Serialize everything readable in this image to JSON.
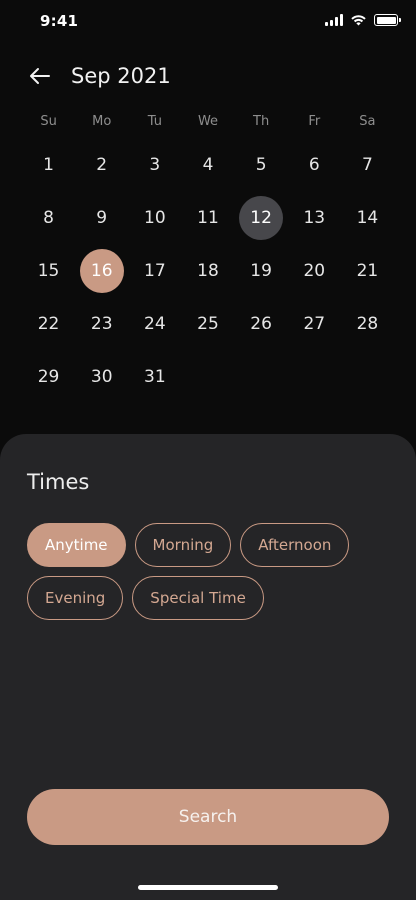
{
  "status_bar": {
    "time": "9:41"
  },
  "header": {
    "month_title": "Sep 2021"
  },
  "calendar": {
    "weekdays": [
      "Su",
      "Mo",
      "Tu",
      "We",
      "Th",
      "Fr",
      "Sa"
    ],
    "days": [
      "1",
      "2",
      "3",
      "4",
      "5",
      "6",
      "7",
      "8",
      "9",
      "10",
      "11",
      "12",
      "13",
      "14",
      "15",
      "16",
      "17",
      "18",
      "19",
      "20",
      "21",
      "22",
      "23",
      "24",
      "25",
      "26",
      "27",
      "28",
      "29",
      "30",
      "31"
    ],
    "today": "12",
    "selected": "16"
  },
  "times_sheet": {
    "title": "Times",
    "chips": [
      "Anytime",
      "Morning",
      "Afternoon",
      "Evening",
      "Special Time"
    ],
    "active_chip": "Anytime",
    "search_label": "Search"
  },
  "colors": {
    "accent": "#c99a84",
    "background": "#0b0b0b",
    "sheet": "#252527",
    "today_bg": "#47474b"
  }
}
